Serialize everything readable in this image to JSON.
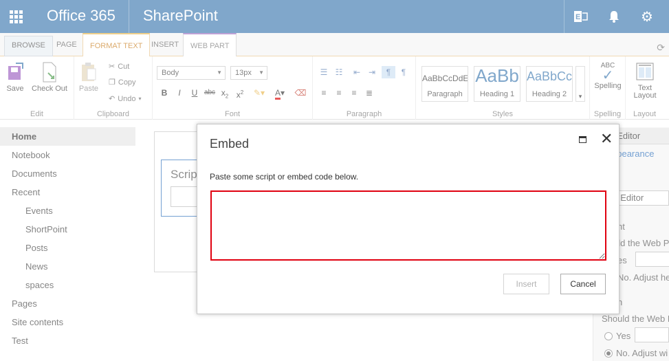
{
  "suitebar": {
    "brand": "Office 365",
    "app": "SharePoint",
    "icons": [
      "waffle-icon",
      "exchange-icon",
      "bell-icon",
      "gear-icon"
    ]
  },
  "ribbon": {
    "tabs": [
      "BROWSE",
      "PAGE",
      "FORMAT TEXT",
      "INSERT",
      "WEB PART"
    ],
    "active_tab": "FORMAT TEXT",
    "edit": {
      "save": "Save",
      "checkout": "Check Out",
      "label": "Edit"
    },
    "clipboard": {
      "paste": "Paste",
      "cut": "Cut",
      "copy": "Copy",
      "undo": "Undo",
      "label": "Clipboard"
    },
    "font": {
      "family": "Body",
      "size": "13px",
      "label": "Font"
    },
    "paragraph": {
      "label": "Paragraph"
    },
    "styles": {
      "items": [
        {
          "sample": "AaBbCcDdE",
          "name": "Paragraph"
        },
        {
          "sample": "AaBb",
          "name": "Heading 1"
        },
        {
          "sample": "AaBbCc",
          "name": "Heading 2"
        }
      ],
      "label": "Styles"
    },
    "spelling": {
      "abc": "ABC",
      "btn": "Spelling",
      "label": "Spelling"
    },
    "layout": {
      "btn_line1": "Text",
      "btn_line2": "Layout",
      "label": "Layout"
    }
  },
  "nav": {
    "items": [
      {
        "label": "Home",
        "level": 0,
        "active": true
      },
      {
        "label": "Notebook",
        "level": 0
      },
      {
        "label": "Documents",
        "level": 0
      },
      {
        "label": "Recent",
        "level": 0
      },
      {
        "label": "Events",
        "level": 1
      },
      {
        "label": "ShortPoint",
        "level": 1
      },
      {
        "label": "Posts",
        "level": 1
      },
      {
        "label": "News",
        "level": 1
      },
      {
        "label": "spaces",
        "level": 1
      },
      {
        "label": "Pages",
        "level": 0
      },
      {
        "label": "Site contents",
        "level": 0
      },
      {
        "label": "Test",
        "level": 0
      }
    ]
  },
  "webpart": {
    "title": "Scrip"
  },
  "toolpane": {
    "header": "t Editor",
    "appearance": "ppearance",
    "title_value": "t Editor",
    "height_head": "nt",
    "height_q": "uld the Web P",
    "yes1": "es",
    "no1": "No. Adjust he",
    "width_head": "h",
    "width_q": "Should the Web P",
    "yes2": "Yes",
    "no2": "No. Adjust wi"
  },
  "dialog": {
    "title": "Embed",
    "instruction": "Paste some script or embed code below.",
    "textarea_value": "",
    "insert": "Insert",
    "cancel": "Cancel",
    "highlight_color": "#e0000f"
  },
  "colors": {
    "suitebar": "#3c79b0",
    "accent": "#c87d1c"
  }
}
